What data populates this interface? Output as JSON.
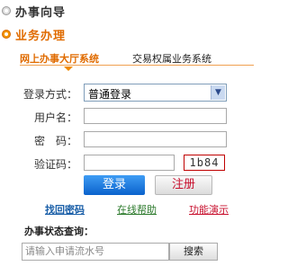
{
  "nav": {
    "guide_label": "办事向导",
    "business_label": "业务办理"
  },
  "tabs": {
    "online_hall": "网上办事大厅系统",
    "trade_system": "交易权属业务系统"
  },
  "login": {
    "mode_label": "登录方式：",
    "mode_value": "普通登录",
    "username_label": "用户名：",
    "password_label": "密　码：",
    "captcha_label": "验证码：",
    "captcha_code": "1b84",
    "login_button": "登录",
    "register_button": "注册"
  },
  "links": {
    "retrieve_password": "找回密码",
    "online_help": "在线帮助",
    "demo": "功能演示"
  },
  "query": {
    "title": "办事状态查询：",
    "placeholder": "请输入申请流水号",
    "search_button": "搜索"
  },
  "colors": {
    "accent_orange": "#e06b00",
    "login_blue": "#0a62cc",
    "register_red": "#c8102e"
  }
}
